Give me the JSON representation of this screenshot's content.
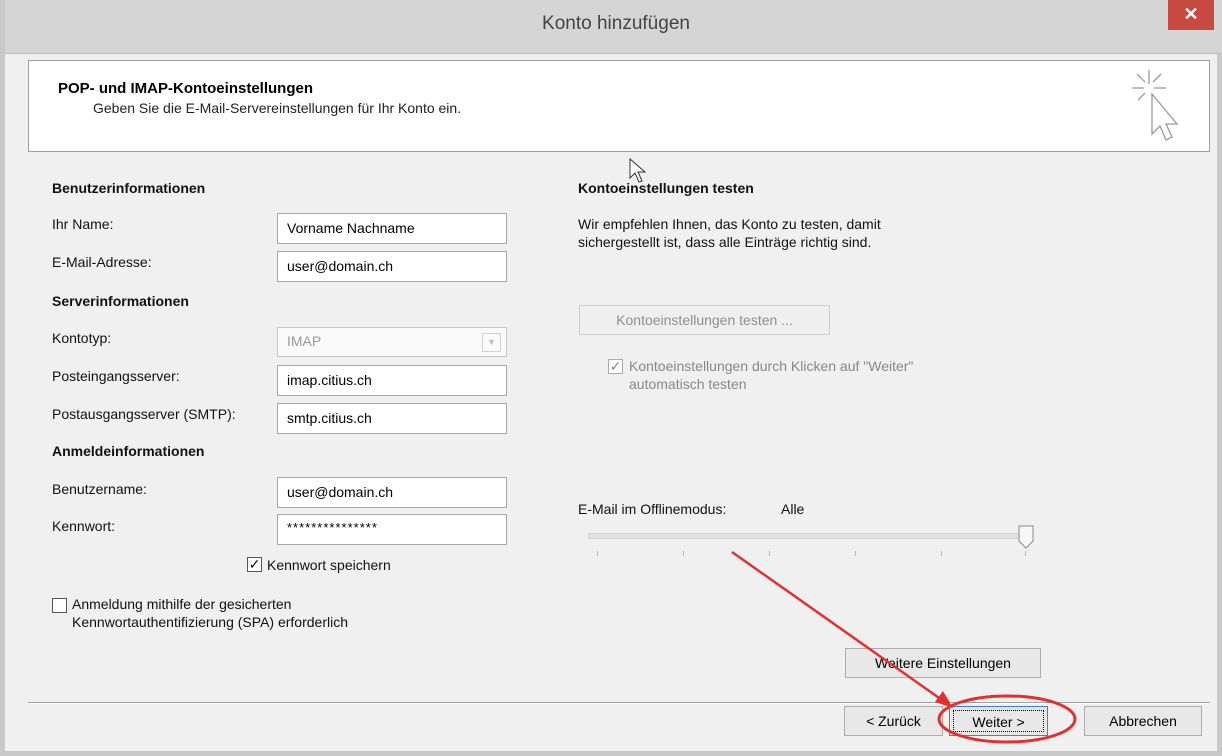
{
  "window": {
    "title": "Konto hinzufügen",
    "close_glyph": "✕"
  },
  "header": {
    "title": "POP- und IMAP-Kontoeinstellungen",
    "subtitle": "Geben Sie die E-Mail-Servereinstellungen für Ihr Konto ein.",
    "icon": "cursor-sparkle-icon"
  },
  "user_info": {
    "heading": "Benutzerinformationen",
    "name_label": "Ihr Name:",
    "name_value": "Vorname Nachname",
    "email_label": "E-Mail-Adresse:",
    "email_value": "user@domain.ch"
  },
  "server_info": {
    "heading": "Serverinformationen",
    "account_type_label": "Kontotyp:",
    "account_type_value": "IMAP",
    "incoming_label": "Posteingangsserver:",
    "incoming_value": "imap.citius.ch",
    "outgoing_label": "Postausgangsserver (SMTP):",
    "outgoing_value": "smtp.citius.ch"
  },
  "login_info": {
    "heading": "Anmeldeinformationen",
    "username_label": "Benutzername:",
    "username_value": "user@domain.ch",
    "password_label": "Kennwort:",
    "password_value": "***************",
    "remember_label": "Kennwort speichern",
    "remember_checked": true,
    "spa_label_line1": "Anmeldung mithilfe der gesicherten",
    "spa_label_line2": "Kennwortauthentifizierung (SPA) erforderlich",
    "spa_checked": false
  },
  "test_section": {
    "heading": "Kontoeinstellungen testen",
    "desc_line1": "Wir empfehlen Ihnen, das Konto zu testen, damit",
    "desc_line2": "sichergestellt ist, dass alle Einträge richtig sind.",
    "test_button": "Kontoeinstellungen testen ...",
    "auto_test_line1": "Kontoeinstellungen durch Klicken auf \"Weiter\"",
    "auto_test_line2": "automatisch testen",
    "auto_test_checked": true
  },
  "offline": {
    "label": "E-Mail im Offlinemodus:",
    "value": "Alle",
    "slider_level": 1.0
  },
  "more_settings_button": "Weitere Einstellungen",
  "footer": {
    "back_button": "< Zurück",
    "next_button": "Weiter >",
    "cancel_button": "Abbrechen"
  },
  "annotation": {
    "color": "#e03030",
    "shape": "arrow pointing to circled Weiter button"
  },
  "colors": {
    "close_button": "#c74a42",
    "title_bar": "#d5d5d5",
    "default_button_border": "#3a83d8"
  }
}
